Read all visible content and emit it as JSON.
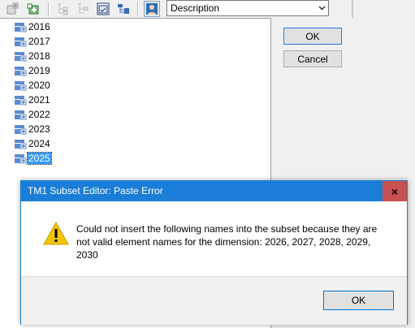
{
  "toolbar": {
    "icons": [
      "add-element-icon",
      "insert-element-icon",
      "expand-icon",
      "collapse-icon",
      "subset-all-icon",
      "hierarchy-icon",
      "alias-icon"
    ],
    "display_combo": {
      "value": "Description"
    }
  },
  "elements": {
    "items": [
      {
        "label": "2016"
      },
      {
        "label": "2017"
      },
      {
        "label": "2018"
      },
      {
        "label": "2019"
      },
      {
        "label": "2020"
      },
      {
        "label": "2021"
      },
      {
        "label": "2022"
      },
      {
        "label": "2023"
      },
      {
        "label": "2024"
      },
      {
        "label": "2025"
      }
    ],
    "selected_index": 9
  },
  "side_buttons": {
    "ok_label": "OK",
    "cancel_label": "Cancel"
  },
  "dialog": {
    "title": "TM1 Subset Editor:  Paste Error",
    "close_glyph": "×",
    "message_line1": "Could not insert the following names into the subset because they are",
    "message_line2": "not valid element names for the dimension:  2026, 2027, 2028, 2029,",
    "message_line3": "2030",
    "ok_label": "OK"
  },
  "colors": {
    "titlebar": "#1a7dd7",
    "close": "#c75050",
    "selection": "#3399ff",
    "warning": "#f5c400"
  }
}
